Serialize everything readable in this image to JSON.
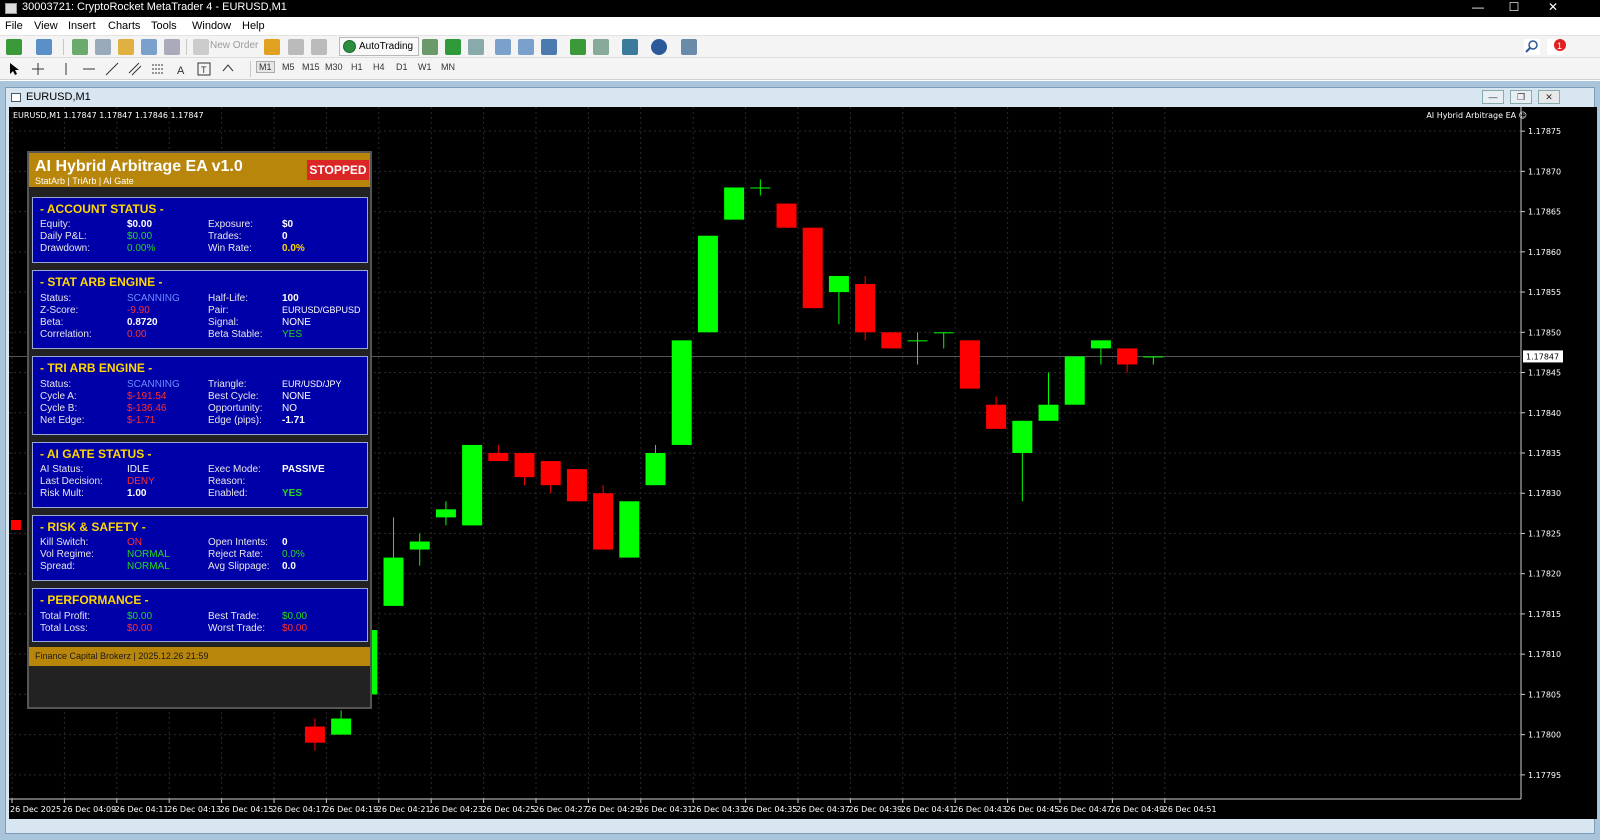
{
  "window": {
    "title": "30003721: CryptoRocket MetaTrader 4 - EURUSD,M1",
    "minimize": "—",
    "maximize": "☐",
    "close": "✕"
  },
  "menu": [
    "File",
    "View",
    "Insert",
    "Charts",
    "Tools",
    "Window",
    "Help"
  ],
  "toolbar": {
    "new_order": "New Order",
    "auto_trading": "AutoTrading",
    "timeframes": [
      "M1",
      "M5",
      "M15",
      "M30",
      "H1",
      "H4",
      "D1",
      "W1",
      "MN"
    ],
    "active_timeframe": "M1",
    "notification_count": "1"
  },
  "chart_window": {
    "title": "EURUSD,M1",
    "symbol_info": "EURUSD,M1  1.17847 1.17847 1.17846 1.17847",
    "ea_name": "AI Hybrid Arbitrage EA ☺",
    "current_price": "1.17847"
  },
  "panel": {
    "title": "AI Hybrid Arbitrage EA v1.0",
    "subtitle": "StatArb | TriArb | AI Gate",
    "status_badge": "STOPPED",
    "account": {
      "header": "- ACCOUNT STATUS -",
      "equity_label": "Equity:",
      "equity": "$0.00",
      "daily_pl_label": "Daily P&L:",
      "daily_pl": "$0.00",
      "drawdown_label": "Drawdown:",
      "drawdown": "0.00%",
      "exposure_label": "Exposure:",
      "exposure": "$0",
      "trades_label": "Trades:",
      "trades": "0",
      "winrate_label": "Win Rate:",
      "winrate": "0.0%"
    },
    "statarb": {
      "header": "- STAT ARB ENGINE -",
      "status_label": "Status:",
      "status": "SCANNING",
      "zscore_label": "Z-Score:",
      "zscore": "-9.90",
      "beta_label": "Beta:",
      "beta": "0.8720",
      "corr_label": "Correlation:",
      "corr": "0.00",
      "halflife_label": "Half-Life:",
      "halflife": "100",
      "pair_label": "Pair:",
      "pair": "EURUSD/GBPUSD",
      "signal_label": "Signal:",
      "signal": "NONE",
      "betastable_label": "Beta Stable:",
      "betastable": "YES"
    },
    "triarb": {
      "header": "- TRI ARB ENGINE -",
      "status_label": "Status:",
      "status": "SCANNING",
      "cyclea_label": "Cycle A:",
      "cyclea": "$-191.54",
      "cycleb_label": "Cycle B:",
      "cycleb": "$-136.46",
      "netedge_label": "Net Edge:",
      "netedge": "$-1.71",
      "triangle_label": "Triangle:",
      "triangle": "EUR/USD/JPY",
      "bestcycle_label": "Best Cycle:",
      "bestcycle": "NONE",
      "opportunity_label": "Opportunity:",
      "opportunity": "NO",
      "edgepips_label": "Edge (pips):",
      "edgepips": "-1.71"
    },
    "aigate": {
      "header": "- AI GATE STATUS -",
      "aistatus_label": "AI Status:",
      "aistatus": "IDLE",
      "lastdecision_label": "Last Decision:",
      "lastdecision": "DENY",
      "riskmult_label": "Risk Mult:",
      "riskmult": "1.00",
      "execmode_label": "Exec Mode:",
      "execmode": "PASSIVE",
      "reason_label": "Reason:",
      "reason": "",
      "enabled_label": "Enabled:",
      "enabled": "YES"
    },
    "risk": {
      "header": "- RISK & SAFETY -",
      "kill_label": "Kill Switch:",
      "kill": "ON",
      "volregime_label": "Vol Regime:",
      "volregime": "NORMAL",
      "spread_label": "Spread:",
      "spread": "NORMAL",
      "openintents_label": "Open Intents:",
      "openintents": "0",
      "rejectrate_label": "Reject Rate:",
      "rejectrate": "0.0%",
      "avgslip_label": "Avg Slippage:",
      "avgslip": "0.0"
    },
    "performance": {
      "header": "- PERFORMANCE -",
      "totalprofit_label": "Total Profit:",
      "totalprofit": "$0.00",
      "totalloss_label": "Total Loss:",
      "totalloss": "$0.00",
      "besttrade_label": "Best Trade:",
      "besttrade": "$0.00",
      "worsttrade_label": "Worst Trade:",
      "worsttrade": "$0.00"
    },
    "footer": "Finance Capital Brokerz | 2025.12.26 21:59"
  },
  "chart_data": {
    "type": "candlestick",
    "title": "EURUSD,M1",
    "y_ticks": [
      "1.17875",
      "1.17870",
      "1.17865",
      "1.17860",
      "1.17855",
      "1.17850",
      "1.17845",
      "1.17840",
      "1.17835",
      "1.17830",
      "1.17825",
      "1.17820",
      "1.17815",
      "1.17810",
      "1.17805",
      "1.17800",
      "1.17795"
    ],
    "ylim": [
      1.17792,
      1.17878
    ],
    "x_ticks": [
      "26 Dec 2025",
      "26 Dec 04:09",
      "26 Dec 04:11",
      "26 Dec 04:13",
      "26 Dec 04:15",
      "26 Dec 04:17",
      "26 Dec 04:19",
      "26 Dec 04:21",
      "26 Dec 04:23",
      "26 Dec 04:25",
      "26 Dec 04:27",
      "26 Dec 04:29",
      "26 Dec 04:31",
      "26 Dec 04:33",
      "26 Dec 04:35",
      "26 Dec 04:37",
      "26 Dec 04:39",
      "26 Dec 04:41",
      "26 Dec 04:43",
      "26 Dec 04:45",
      "26 Dec 04:47",
      "26 Dec 04:49",
      "26 Dec 04:51"
    ],
    "bull_color": "#00ff00",
    "bear_color": "#ff0000",
    "candles": [
      {
        "slot": 11.6,
        "o": 1.17801,
        "h": 1.17802,
        "l": 1.17798,
        "c": 1.17799
      },
      {
        "slot": 12.6,
        "o": 1.178,
        "h": 1.17803,
        "l": 1.178,
        "c": 1.17802
      },
      {
        "slot": 13.6,
        "o": 1.17805,
        "h": 1.17815,
        "l": 1.17805,
        "c": 1.17813
      },
      {
        "slot": 14.6,
        "o": 1.17816,
        "h": 1.17827,
        "l": 1.17816,
        "c": 1.17822
      },
      {
        "slot": 15.6,
        "o": 1.17823,
        "h": 1.17825,
        "l": 1.17821,
        "c": 1.17824
      },
      {
        "slot": 16.6,
        "o": 1.17827,
        "h": 1.17829,
        "l": 1.17826,
        "c": 1.17828
      },
      {
        "slot": 17.6,
        "o": 1.17826,
        "h": 1.17836,
        "l": 1.17826,
        "c": 1.17836
      },
      {
        "slot": 18.6,
        "o": 1.17835,
        "h": 1.17836,
        "l": 1.17834,
        "c": 1.17834
      },
      {
        "slot": 19.6,
        "o": 1.17835,
        "h": 1.17835,
        "l": 1.17831,
        "c": 1.17832
      },
      {
        "slot": 20.6,
        "o": 1.17834,
        "h": 1.17834,
        "l": 1.1783,
        "c": 1.17831
      },
      {
        "slot": 21.6,
        "o": 1.17833,
        "h": 1.17833,
        "l": 1.17829,
        "c": 1.17829
      },
      {
        "slot": 22.6,
        "o": 1.1783,
        "h": 1.17831,
        "l": 1.17823,
        "c": 1.17823
      },
      {
        "slot": 23.6,
        "o": 1.17822,
        "h": 1.17829,
        "l": 1.17822,
        "c": 1.17829
      },
      {
        "slot": 24.6,
        "o": 1.17831,
        "h": 1.17836,
        "l": 1.17831,
        "c": 1.17835
      },
      {
        "slot": 25.6,
        "o": 1.17836,
        "h": 1.17849,
        "l": 1.17836,
        "c": 1.17849
      },
      {
        "slot": 26.6,
        "o": 1.1785,
        "h": 1.17862,
        "l": 1.1785,
        "c": 1.17862
      },
      {
        "slot": 27.6,
        "o": 1.17864,
        "h": 1.17868,
        "l": 1.17864,
        "c": 1.17868
      },
      {
        "slot": 28.6,
        "o": 1.17868,
        "h": 1.17869,
        "l": 1.17867,
        "c": 1.17868
      },
      {
        "slot": 29.6,
        "o": 1.17866,
        "h": 1.17866,
        "l": 1.17863,
        "c": 1.17863
      },
      {
        "slot": 30.6,
        "o": 1.17863,
        "h": 1.17863,
        "l": 1.17853,
        "c": 1.17853
      },
      {
        "slot": 31.6,
        "o": 1.17855,
        "h": 1.17857,
        "l": 1.17851,
        "c": 1.17857
      },
      {
        "slot": 32.6,
        "o": 1.17856,
        "h": 1.17857,
        "l": 1.17849,
        "c": 1.1785
      },
      {
        "slot": 33.6,
        "o": 1.1785,
        "h": 1.1785,
        "l": 1.17848,
        "c": 1.17848
      },
      {
        "slot": 34.6,
        "o": 1.17849,
        "h": 1.1785,
        "l": 1.17846,
        "c": 1.17849
      },
      {
        "slot": 35.6,
        "o": 1.1785,
        "h": 1.1785,
        "l": 1.17848,
        "c": 1.1785
      },
      {
        "slot": 36.6,
        "o": 1.17849,
        "h": 1.17849,
        "l": 1.17843,
        "c": 1.17843
      },
      {
        "slot": 37.6,
        "o": 1.17841,
        "h": 1.17842,
        "l": 1.17838,
        "c": 1.17838
      },
      {
        "slot": 38.6,
        "o": 1.17835,
        "h": 1.17839,
        "l": 1.17829,
        "c": 1.17839
      },
      {
        "slot": 39.6,
        "o": 1.17839,
        "h": 1.17845,
        "l": 1.17839,
        "c": 1.17841
      },
      {
        "slot": 40.6,
        "o": 1.17841,
        "h": 1.17847,
        "l": 1.17841,
        "c": 1.17847
      },
      {
        "slot": 41.6,
        "o": 1.17848,
        "h": 1.17849,
        "l": 1.17846,
        "c": 1.17849
      },
      {
        "slot": 42.6,
        "o": 1.17848,
        "h": 1.17848,
        "l": 1.17845,
        "c": 1.17846
      },
      {
        "slot": 43.6,
        "o": 1.17847,
        "h": 1.17847,
        "l": 1.17846,
        "c": 1.17847
      }
    ]
  }
}
